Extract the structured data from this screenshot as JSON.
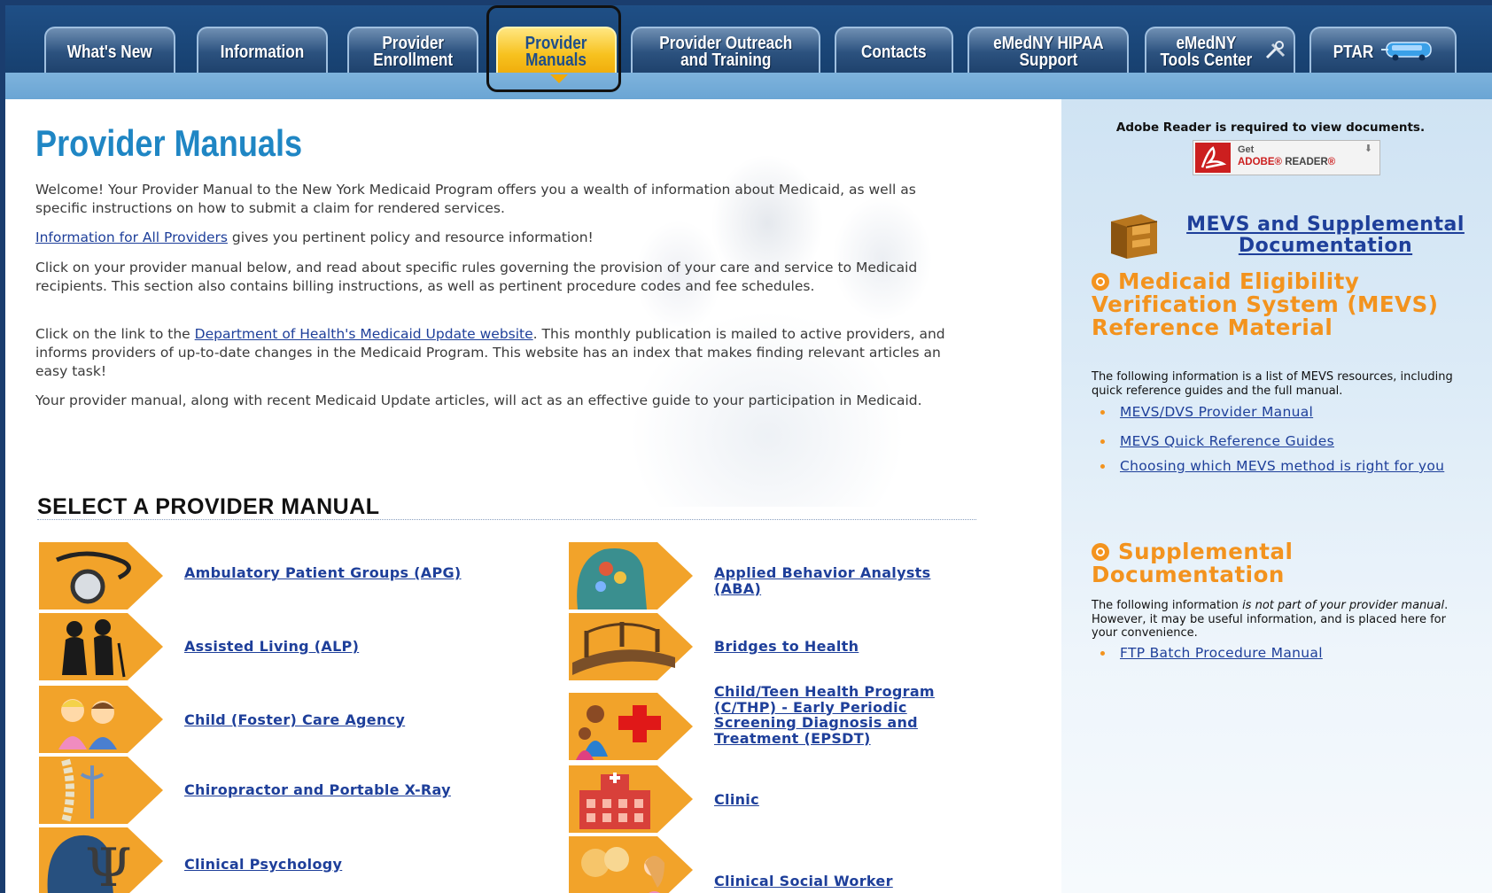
{
  "nav": {
    "tabs": [
      {
        "label": "What's New",
        "active": false
      },
      {
        "label": "Information",
        "active": false
      },
      {
        "label": "Provider\nEnrollment",
        "active": false
      },
      {
        "label": "Provider\nManuals",
        "active": true
      },
      {
        "label": "Provider Outreach\nand Training",
        "active": false
      },
      {
        "label": "Contacts",
        "active": false
      },
      {
        "label": "eMedNY HIPAA\nSupport",
        "active": false
      },
      {
        "label": "eMedNY\nTools Center",
        "icon": "tools-icon",
        "active": false
      },
      {
        "label": "PTAR",
        "icon": "bus-icon",
        "active": false
      }
    ]
  },
  "main": {
    "title": "Provider Manuals",
    "intro": "Welcome! Your Provider Manual to the New York Medicaid Program offers you a wealth of information about Medicaid, as well as specific instructions on how to submit a claim for rendered services.",
    "all_providers_link": "Information for All Providers",
    "all_providers_text": " gives you pertinent policy and resource information!",
    "click_manual": "Click on your provider manual below, and read about specific rules governing the provision of your care and service to Medicaid recipients. This section also contains billing instructions, as well as pertinent procedure codes and fee schedules.",
    "update_pre": "Click on the link to the ",
    "update_link": "Department of Health's Medicaid Update website",
    "update_post": ". This monthly publication is mailed to active providers, and informs providers of up-to-date changes in the Medicaid Program. This website has an index that makes finding relevant articles an easy task!",
    "closing": "Your provider manual, along with recent Medicaid Update articles, will act as an effective guide to your participation in Medicaid.",
    "select_heading": "SELECT A PROVIDER MANUAL",
    "manuals_left": [
      {
        "label": "Ambulatory Patient Groups (APG)",
        "icon": "stethoscope-icon"
      },
      {
        "label": "Assisted Living (ALP)",
        "icon": "elderly-couple-icon"
      },
      {
        "label": "Child (Foster) Care Agency",
        "icon": "children-icon"
      },
      {
        "label": "Chiropractor and Portable X-Ray",
        "icon": "spine-icon"
      },
      {
        "label": "Clinical Psychology",
        "icon": "psi-head-icon"
      }
    ],
    "manuals_right": [
      {
        "label": "Applied Behavior Analysts (ABA)",
        "icon": "brain-head-icon"
      },
      {
        "label": "Bridges to Health",
        "icon": "bridge-icon"
      },
      {
        "label": "Child/Teen Health Program (C/THP) - Early Periodic Screening Diagnosis and Treatment (EPSDT)",
        "icon": "family-red-cross-icon"
      },
      {
        "label": "Clinic",
        "icon": "clinic-building-icon"
      },
      {
        "label": "Clinical Social Worker",
        "icon": "social-worker-icon"
      }
    ]
  },
  "sidebar": {
    "adobe_note": "Adobe Reader is required to view documents.",
    "adobe_get": "Get",
    "adobe_brand": "ADOBE",
    "adobe_reader": "READER",
    "mevs_link": "MEVS and Supplemental Documentation",
    "mevs_heading": "Medicaid Eligibility Verification System (MEVS) Reference Material",
    "mevs_text": "The following information is a list of MEVS resources, including quick reference guides and the full manual.",
    "mevs_links": [
      "MEVS/DVS Provider Manual",
      "MEVS Quick Reference Guides",
      "Choosing which MEVS method is right for you"
    ],
    "supp_heading": "Supplemental Documentation",
    "supp_text_pre": "The following information ",
    "supp_text_em": "is not part of your provider manual",
    "supp_text_post": ". However, it may be useful information, and is placed here for your convenience.",
    "supp_links": [
      "FTP Batch Procedure Manual"
    ]
  },
  "colors": {
    "nav_bg": "#1f4f86",
    "active_tab": "#f7c21f",
    "title_blue": "#1f86c4",
    "link_blue": "#1e3f9a",
    "accent_orange": "#f3931e",
    "icon_orange": "#f2a32a"
  }
}
